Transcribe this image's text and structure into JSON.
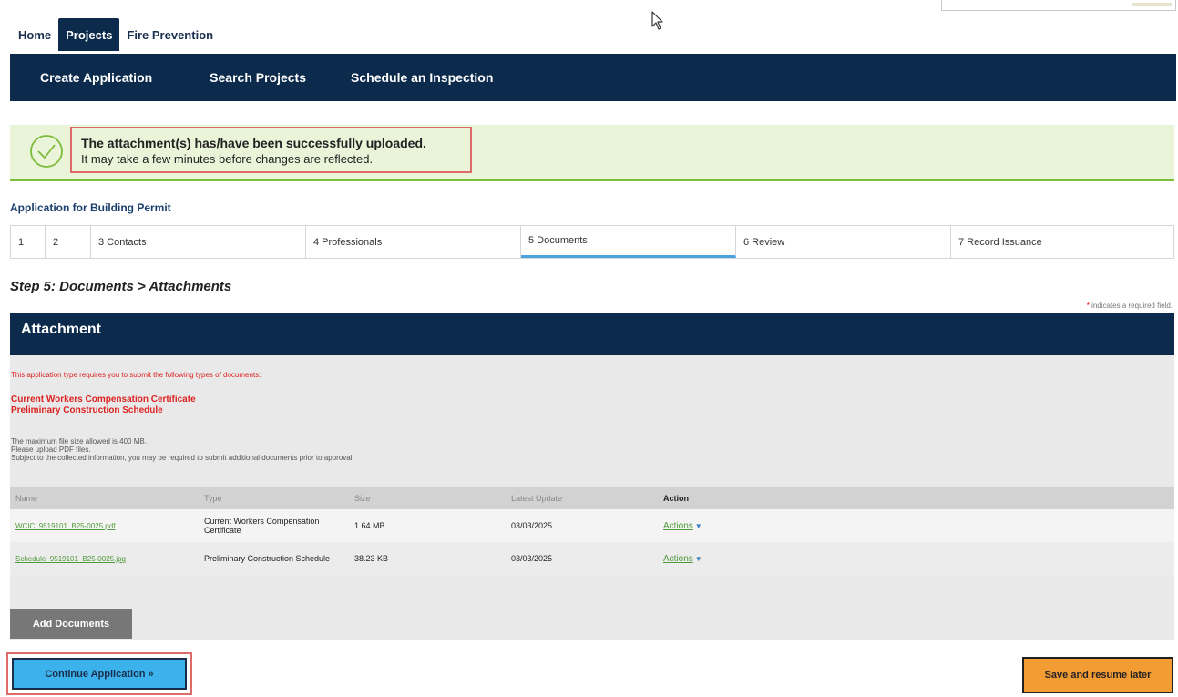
{
  "top_tabs": [
    "Home",
    "Projects",
    "Fire Prevention"
  ],
  "nav": [
    "Create Application",
    "Search Projects",
    "Schedule an Inspection"
  ],
  "success": {
    "icon": "check-circle-icon",
    "title": "The attachment(s) has/have been successfully uploaded.",
    "subtitle": "It may take a few minutes before changes are reflected."
  },
  "app_title": "Application for Building Permit",
  "steps": [
    "1",
    "2",
    "3 Contacts",
    "4 Professionals",
    "5 Documents",
    "6 Review",
    "7 Record Issuance"
  ],
  "active_step": "5 Documents",
  "step_heading": "Step 5: Documents > Attachments",
  "required_note": {
    "star": "*",
    "text": "indicates a required field."
  },
  "attachment": {
    "header": "Attachment",
    "notice": "This application type requires you to submit the following types of documents:",
    "required_docs": [
      "Current Workers Compensation Certificate",
      "Preliminary Construction Schedule"
    ],
    "info_lines": [
      "The maximum file size allowed is 400 MB.",
      "Please upload PDF files.",
      "Subject to the collected information, you may be required to submit additional documents prior to approval."
    ],
    "table": {
      "headers": [
        "Name",
        "Type",
        "Size",
        "Latest Update",
        "Action"
      ],
      "rows": [
        {
          "name": "WCIC_9519101_B25-0025.pdf",
          "type": "Current Workers Compensation Certificate",
          "size": "1.64 MB",
          "date": "03/03/2025",
          "action": "Actions"
        },
        {
          "name": "Schedule_9519101_B25-0025.jpg",
          "type": "Preliminary Construction Schedule",
          "size": "38.23 KB",
          "date": "03/03/2025",
          "action": "Actions"
        }
      ]
    },
    "add_button": "Add Documents"
  },
  "buttons": {
    "continue": "Continue Application »",
    "save": "Save and resume later"
  },
  "colors": {
    "navy": "#0b2a4c",
    "success_bg": "#eaf4d9",
    "success_border": "#7dbb3a",
    "required_red": "#d22222",
    "continue_blue": "#3cb2ec",
    "save_orange": "#f39c34",
    "highlight_red": "#e06a6a"
  }
}
